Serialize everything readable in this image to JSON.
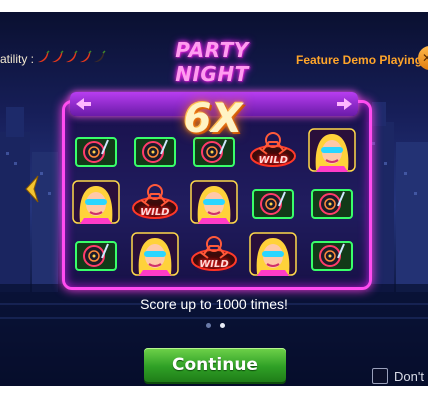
{
  "header": {
    "volatility_label": "atility :",
    "chili_colors": [
      "#e2381c",
      "#e2381c",
      "#e2381c",
      "#e2381c",
      "#3a2a2a"
    ],
    "title": "PARTY NIGHT",
    "feature_status": "Feature Demo Playing",
    "close_icon": "close-icon"
  },
  "preview": {
    "multiplier": "6X",
    "symbols": [
      [
        "turntable",
        "turntable",
        "turntable",
        "dj-wild",
        "dj-girl"
      ],
      [
        "dj-girl",
        "dj-wild",
        "dj-girl",
        "turntable",
        "turntable"
      ],
      [
        "turntable",
        "dj-girl",
        "dj-wild",
        "dj-girl",
        "turntable"
      ]
    ],
    "wild_text": "WILD",
    "caption": "Score up to 1000 times!",
    "page_count": 2,
    "active_page": 1
  },
  "footer": {
    "continue_label": "Continue",
    "dont_show_label": "Don't"
  },
  "colors": {
    "neon_pink": "#ff4cf0",
    "button_green": "#2fa026",
    "feature_orange": "#ffa52a"
  }
}
